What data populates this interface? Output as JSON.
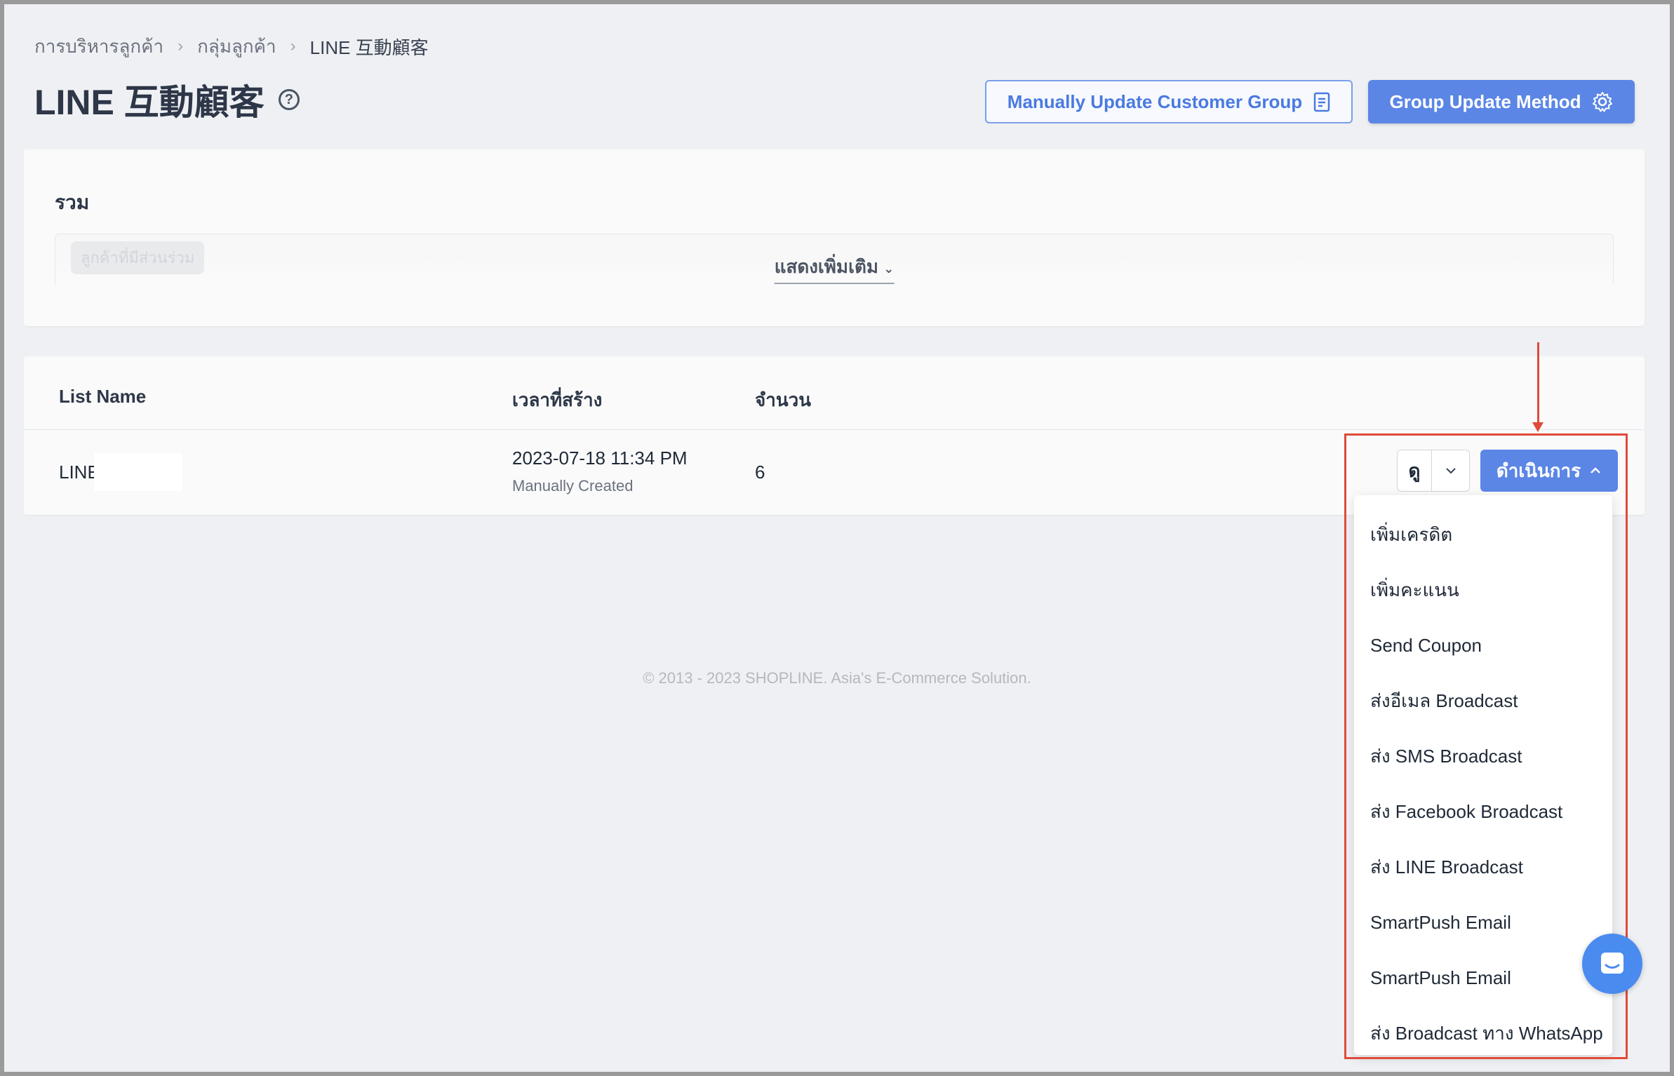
{
  "breadcrumb": {
    "items": [
      "การบริหารลูกค้า",
      "กลุ่มลูกค้า",
      "LINE 互動顧客"
    ]
  },
  "header": {
    "title": "LINE 互動顧客",
    "manual_update_label": "Manually Update Customer Group",
    "group_update_label": "Group Update Method"
  },
  "summary": {
    "title": "รวม",
    "faded_chip": "ลูกค้าที่มีส่วนร่วม",
    "show_more": "แสดงเพิ่มเติม"
  },
  "table": {
    "columns": [
      "List Name",
      "เวลาที่สร้าง",
      "จำนวน"
    ],
    "rows": [
      {
        "name": "LINE",
        "created_at": "2023-07-18 11:34 PM",
        "created_by": "Manually Created",
        "count": "6",
        "view_label": "ดู",
        "action_label": "ดำเนินการ"
      }
    ]
  },
  "dropdown": {
    "items": [
      "เพิ่มเครดิต",
      "เพิ่มคะแนน",
      "Send Coupon",
      "ส่งอีเมล Broadcast",
      "ส่ง SMS Broadcast",
      "ส่ง Facebook Broadcast",
      "ส่ง LINE Broadcast",
      "SmartPush Email",
      "SmartPush Email",
      "ส่ง Broadcast ทาง WhatsApp"
    ]
  },
  "footer": {
    "text": "© 2013 - 2023 SHOPLINE. Asia's E-Commerce Solution."
  },
  "colors": {
    "primary": "#5b86e5",
    "annotation": "#e04a3a",
    "background": "#eff0f3"
  },
  "icons": [
    "chevron-right-icon",
    "help-icon",
    "clipboard-icon",
    "gear-icon",
    "chevron-down-icon",
    "chevron-up-icon",
    "chat-icon"
  ]
}
